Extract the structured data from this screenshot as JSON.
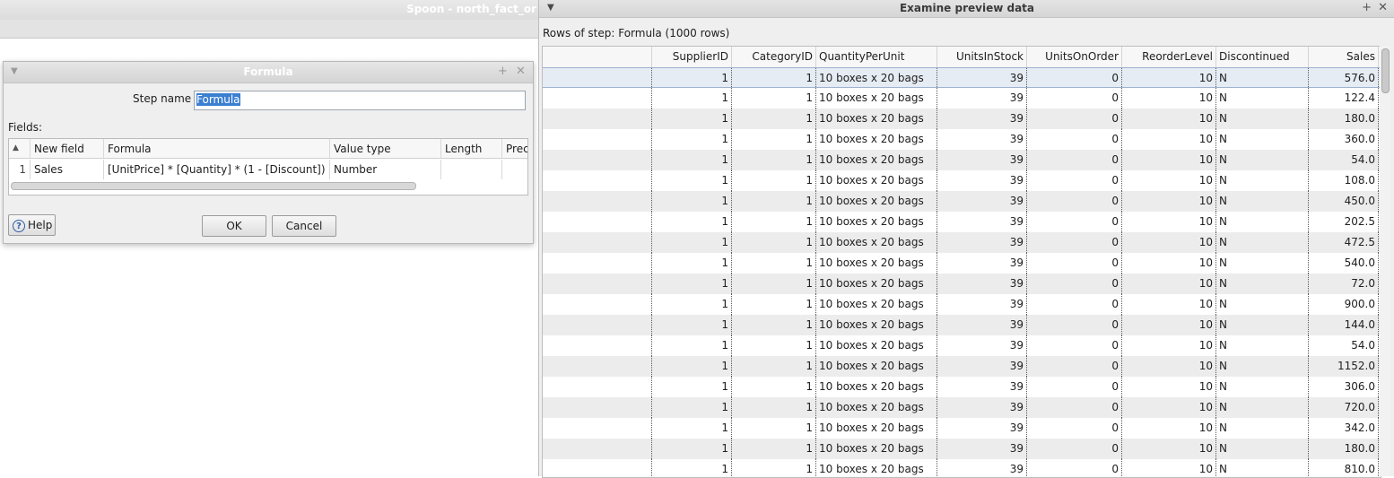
{
  "spoon": {
    "title": "Spoon - north_fact_or"
  },
  "formula_dialog": {
    "title": "Formula",
    "step_name_label": "Step name",
    "step_name_value": "Formula",
    "fields_label": "Fields:",
    "columns": [
      "New field",
      "Formula",
      "Value type",
      "Length",
      "Prec"
    ],
    "rows": [
      {
        "num": "1",
        "new_field": "Sales",
        "formula": "[UnitPrice] * [Quantity] * (1 - [Discount])",
        "value_type": "Number",
        "length": "",
        "precision": ""
      }
    ],
    "help_label": "Help",
    "ok_label": "OK",
    "cancel_label": "Cancel"
  },
  "preview": {
    "title": "Examine preview data",
    "rows_label": "Rows of step: Formula (1000 rows)",
    "columns": [
      "",
      "SupplierID",
      "CategoryID",
      "QuantityPerUnit",
      "UnitsInStock",
      "UnitsOnOrder",
      "ReorderLevel",
      "Discontinued",
      "Sales"
    ],
    "rows": [
      [
        "",
        "1",
        "1",
        "10 boxes x 20 bags",
        "39",
        "0",
        "10",
        "N",
        "576.0"
      ],
      [
        "",
        "1",
        "1",
        "10 boxes x 20 bags",
        "39",
        "0",
        "10",
        "N",
        "122.4"
      ],
      [
        "",
        "1",
        "1",
        "10 boxes x 20 bags",
        "39",
        "0",
        "10",
        "N",
        "180.0"
      ],
      [
        "",
        "1",
        "1",
        "10 boxes x 20 bags",
        "39",
        "0",
        "10",
        "N",
        "360.0"
      ],
      [
        "",
        "1",
        "1",
        "10 boxes x 20 bags",
        "39",
        "0",
        "10",
        "N",
        "54.0"
      ],
      [
        "",
        "1",
        "1",
        "10 boxes x 20 bags",
        "39",
        "0",
        "10",
        "N",
        "108.0"
      ],
      [
        "",
        "1",
        "1",
        "10 boxes x 20 bags",
        "39",
        "0",
        "10",
        "N",
        "450.0"
      ],
      [
        "",
        "1",
        "1",
        "10 boxes x 20 bags",
        "39",
        "0",
        "10",
        "N",
        "202.5"
      ],
      [
        "",
        "1",
        "1",
        "10 boxes x 20 bags",
        "39",
        "0",
        "10",
        "N",
        "472.5"
      ],
      [
        "",
        "1",
        "1",
        "10 boxes x 20 bags",
        "39",
        "0",
        "10",
        "N",
        "540.0"
      ],
      [
        "",
        "1",
        "1",
        "10 boxes x 20 bags",
        "39",
        "0",
        "10",
        "N",
        "72.0"
      ],
      [
        "",
        "1",
        "1",
        "10 boxes x 20 bags",
        "39",
        "0",
        "10",
        "N",
        "900.0"
      ],
      [
        "",
        "1",
        "1",
        "10 boxes x 20 bags",
        "39",
        "0",
        "10",
        "N",
        "144.0"
      ],
      [
        "",
        "1",
        "1",
        "10 boxes x 20 bags",
        "39",
        "0",
        "10",
        "N",
        "54.0"
      ],
      [
        "",
        "1",
        "1",
        "10 boxes x 20 bags",
        "39",
        "0",
        "10",
        "N",
        "1152.0"
      ],
      [
        "",
        "1",
        "1",
        "10 boxes x 20 bags",
        "39",
        "0",
        "10",
        "N",
        "306.0"
      ],
      [
        "",
        "1",
        "1",
        "10 boxes x 20 bags",
        "39",
        "0",
        "10",
        "N",
        "720.0"
      ],
      [
        "",
        "1",
        "1",
        "10 boxes x 20 bags",
        "39",
        "0",
        "10",
        "N",
        "342.0"
      ],
      [
        "",
        "1",
        "1",
        "10 boxes x 20 bags",
        "39",
        "0",
        "10",
        "N",
        "180.0"
      ],
      [
        "",
        "1",
        "1",
        "10 boxes x 20 bags",
        "39",
        "0",
        "10",
        "N",
        "810.0"
      ]
    ]
  },
  "icons": {
    "window_menu": "chevron-down-icon",
    "pin": "plus-icon",
    "close": "close-icon",
    "help": "question-icon",
    "sort": "sort-up-icon"
  },
  "colors": {
    "selection": "#3b7fd1",
    "alt_row": "#ececec"
  }
}
